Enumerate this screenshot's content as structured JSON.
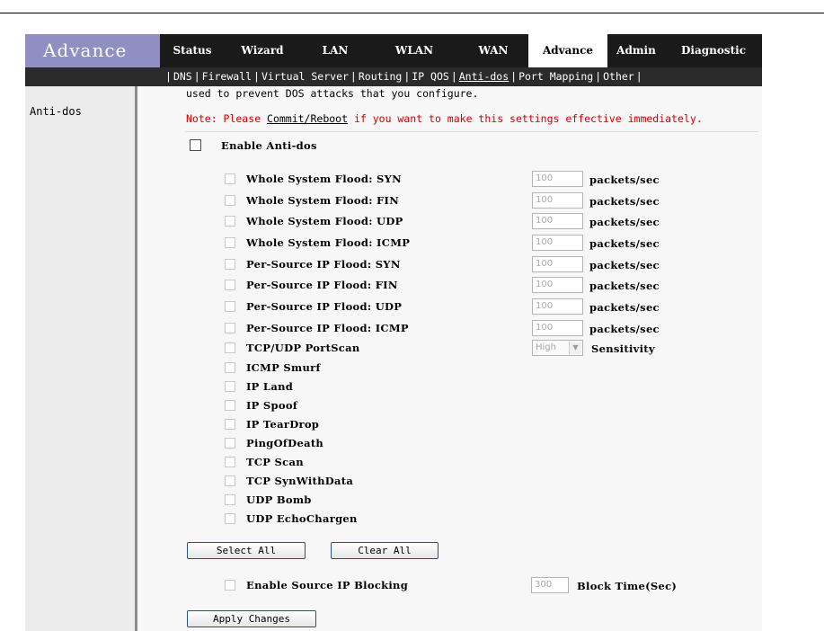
{
  "header": {
    "brand": "Advance",
    "tabs": [
      {
        "label": "Status",
        "active": false
      },
      {
        "label": "Wizard",
        "active": false
      },
      {
        "label": "LAN",
        "active": false
      },
      {
        "label": "WLAN",
        "active": false
      },
      {
        "label": "WAN",
        "active": false
      },
      {
        "label": "Advance",
        "active": true
      },
      {
        "label": "Admin",
        "active": false
      },
      {
        "label": "Diagnostic",
        "active": false
      }
    ]
  },
  "subnav": {
    "items": [
      {
        "label": "DNS",
        "active": false
      },
      {
        "label": "Firewall",
        "active": false
      },
      {
        "label": "Virtual Server",
        "active": false
      },
      {
        "label": "Routing",
        "active": false
      },
      {
        "label": "IP QOS",
        "active": false
      },
      {
        "label": "Anti-dos",
        "active": true
      },
      {
        "label": "Port Mapping",
        "active": false
      },
      {
        "label": "Other",
        "active": false
      }
    ]
  },
  "sidebar": {
    "title": "Anti-dos"
  },
  "main": {
    "description": "used to prevent DOS attacks that you configure.",
    "note_prefix": "Note: Please ",
    "note_link": "Commit/Reboot",
    "note_suffix": " if you want to make this settings effective immediately.",
    "enable_label": "Enable Anti-dos",
    "flood_rows": [
      {
        "label": "Whole System Flood: SYN",
        "value": "100",
        "unit": "packets/sec"
      },
      {
        "label": "Whole System Flood: FIN",
        "value": "100",
        "unit": "packets/sec"
      },
      {
        "label": "Whole System Flood: UDP",
        "value": "100",
        "unit": "packets/sec"
      },
      {
        "label": "Whole System Flood: ICMP",
        "value": "100",
        "unit": "packets/sec"
      },
      {
        "label": "Per-Source IP Flood: SYN",
        "value": "100",
        "unit": "packets/sec"
      },
      {
        "label": "Per-Source IP Flood: FIN",
        "value": "100",
        "unit": "packets/sec"
      },
      {
        "label": "Per-Source IP Flood: UDP",
        "value": "100",
        "unit": "packets/sec"
      },
      {
        "label": "Per-Source IP Flood: ICMP",
        "value": "100",
        "unit": "packets/sec"
      }
    ],
    "portscan": {
      "label": "TCP/UDP PortScan",
      "value": "High",
      "unit": "Sensitivity"
    },
    "options": [
      "ICMP Smurf",
      "IP Land",
      "IP Spoof",
      "IP TearDrop",
      "PingOfDeath",
      "TCP Scan",
      "TCP SynWithData",
      "UDP Bomb",
      "UDP EchoChargen"
    ],
    "select_all": "Select All",
    "clear_all": "Clear All",
    "source_block": {
      "label": "Enable Source IP Blocking",
      "value": "300",
      "unit": "Block Time(Sec)"
    },
    "apply": "Apply Changes"
  }
}
